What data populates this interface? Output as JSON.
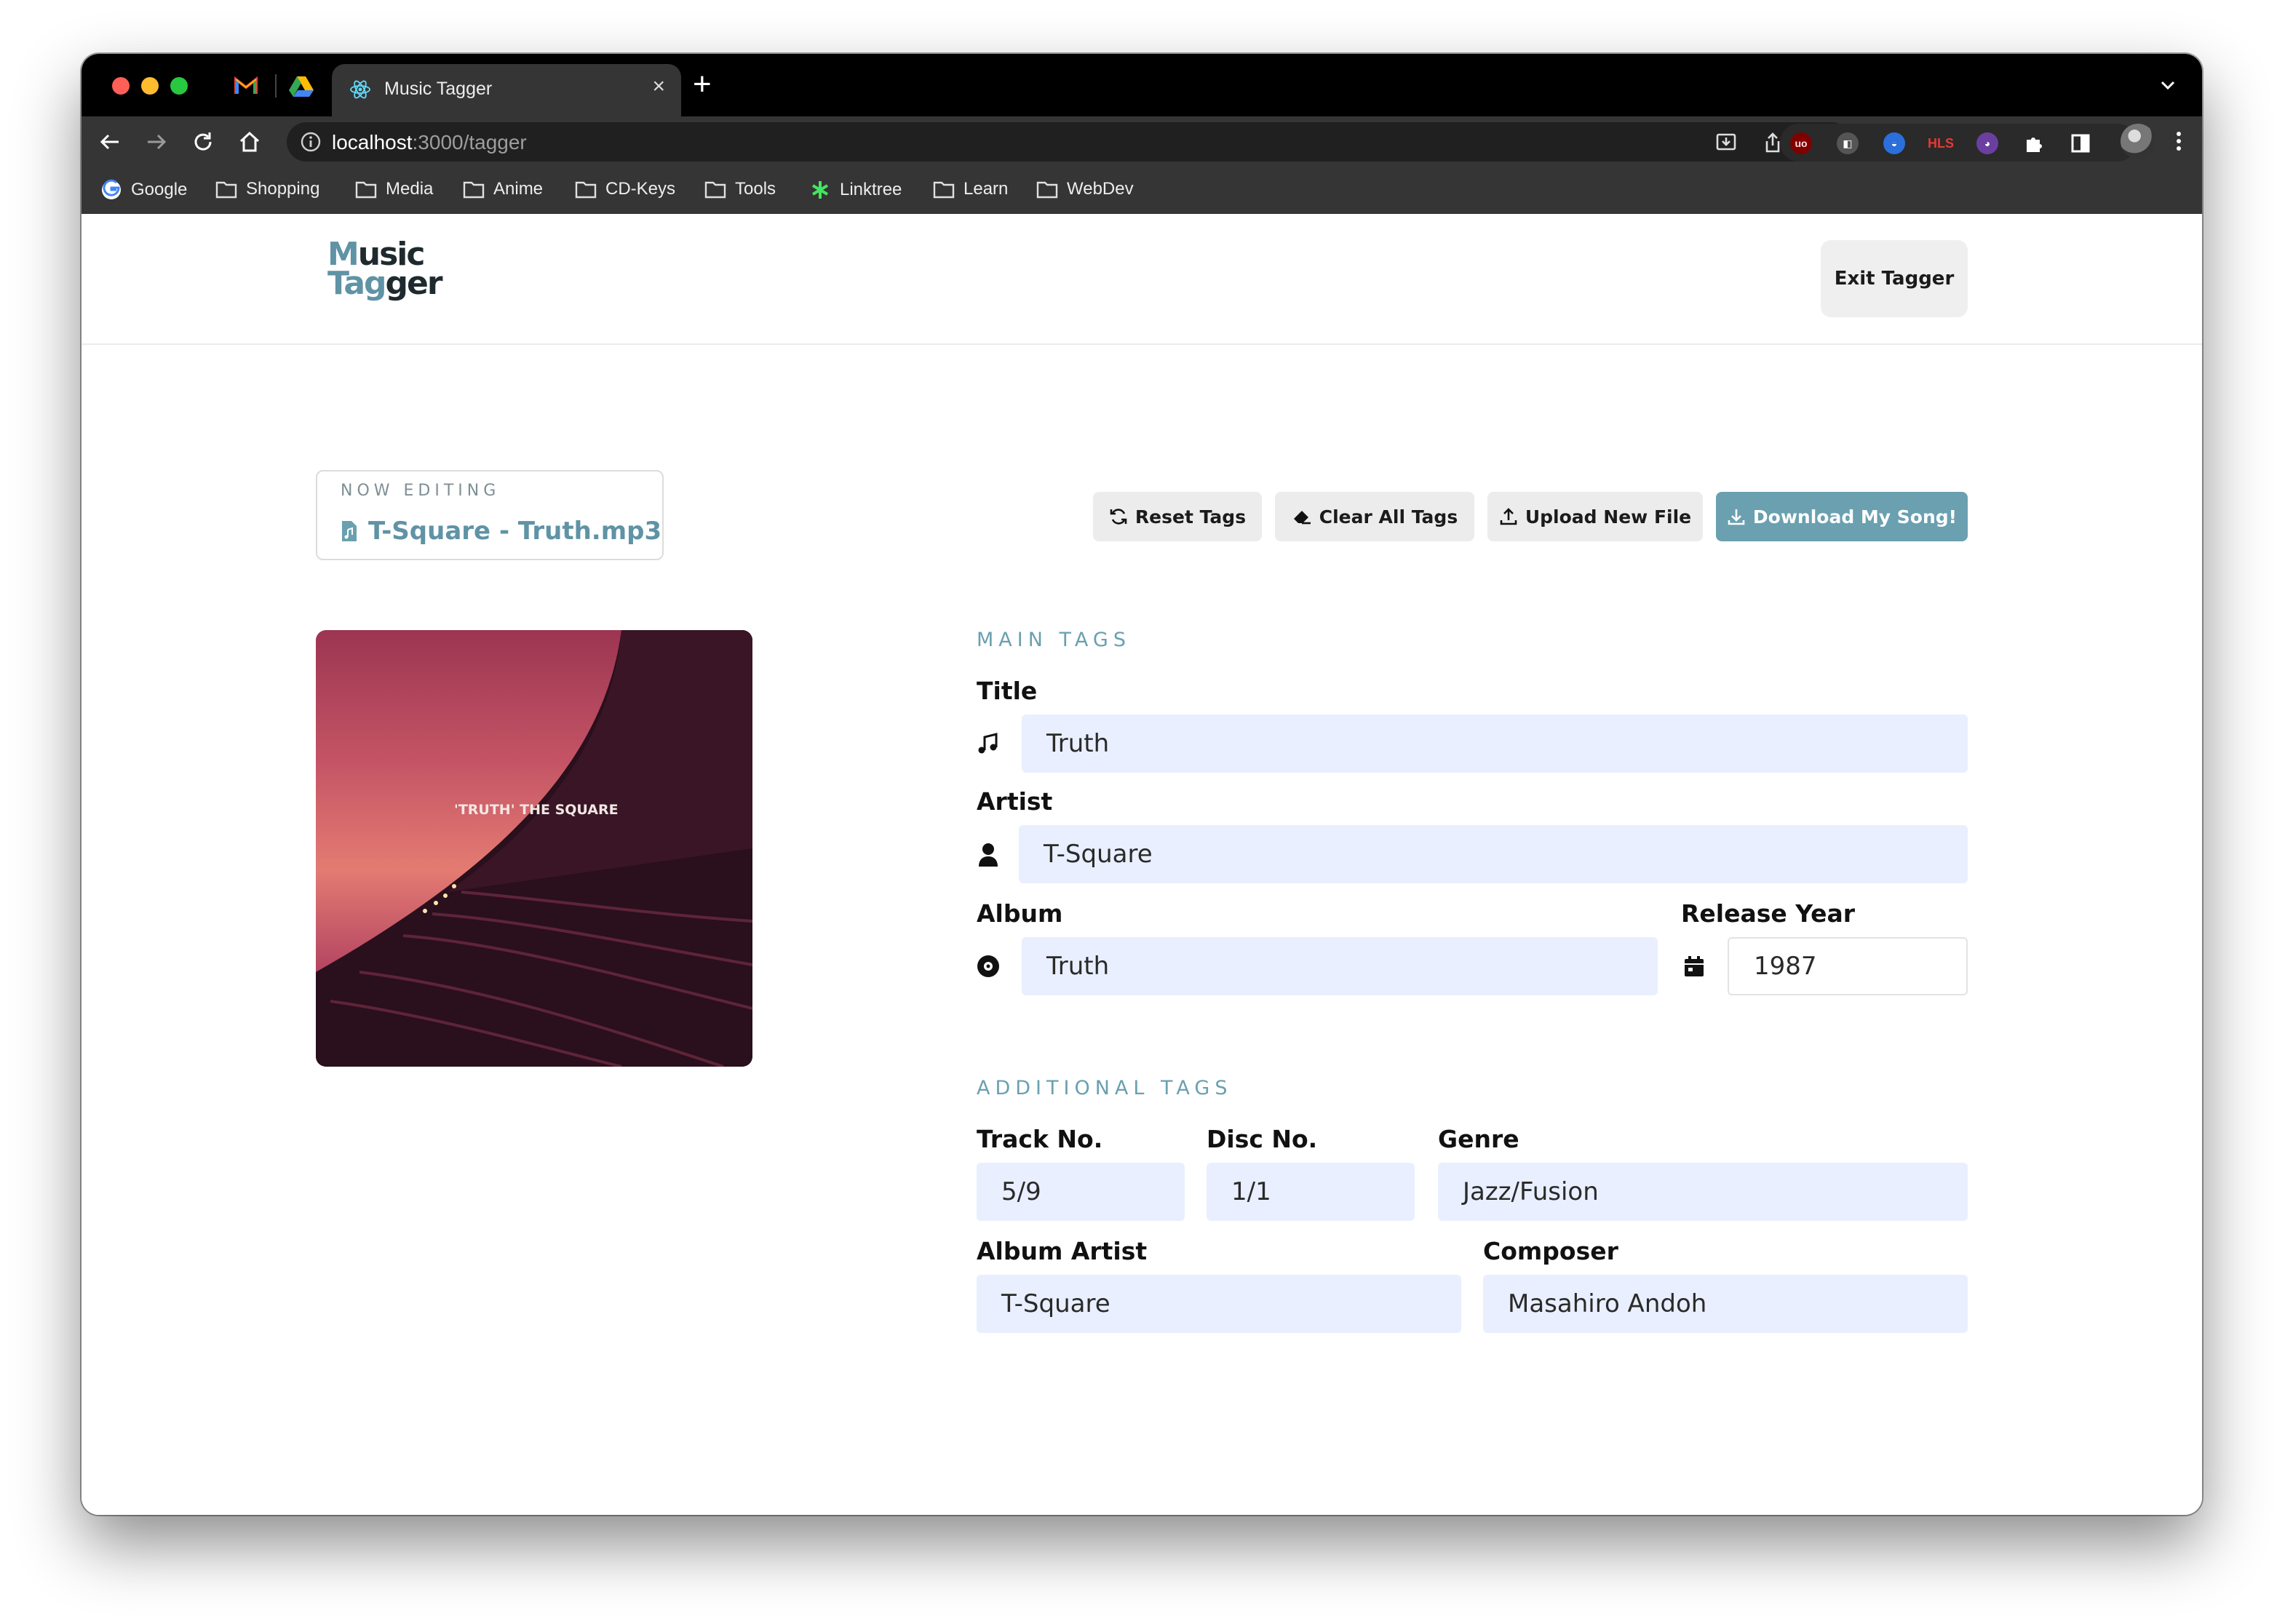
{
  "browser": {
    "tab_title": "Music Tagger",
    "url_host": "localhost",
    "url_path": ":3000/tagger",
    "bookmarks": [
      "Google",
      "Shopping",
      "Media",
      "Anime",
      "CD-Keys",
      "Tools",
      "Linktree",
      "Learn",
      "WebDev"
    ],
    "extensions": [
      "uBlock",
      "extension",
      "extension",
      "HLS",
      "extension"
    ]
  },
  "app": {
    "logo": {
      "line1_a": "M",
      "line1_b": "usic",
      "line2_a": "Ta",
      "line2_b": "g",
      "line2_c": "ger"
    },
    "exit_button": "Exit Tagger",
    "now_editing": {
      "caption": "NOW EDITING",
      "filename": "T-Square - Truth.mp3"
    },
    "actions": {
      "reset": "Reset Tags",
      "clear": "Clear All Tags",
      "upload": "Upload New File",
      "download": "Download My Song!"
    },
    "artwork_text": "'TRUTH' THE SQUARE",
    "main_tags": {
      "caption": "MAIN TAGS",
      "title": {
        "label": "Title",
        "value": "Truth"
      },
      "artist": {
        "label": "Artist",
        "value": "T-Square"
      },
      "album": {
        "label": "Album",
        "value": "Truth"
      },
      "year": {
        "label": "Release Year",
        "value": "1987"
      }
    },
    "additional_tags": {
      "caption": "ADDITIONAL TAGS",
      "track": {
        "label": "Track No.",
        "value": "5/9"
      },
      "disc": {
        "label": "Disc No.",
        "value": "1/1"
      },
      "genre": {
        "label": "Genre",
        "value": "Jazz/Fusion"
      },
      "album_artist": {
        "label": "Album Artist",
        "value": "T-Square"
      },
      "composer": {
        "label": "Composer",
        "value": "Masahiro Andoh"
      }
    }
  },
  "colors": {
    "accent": "#6aa0b0",
    "input_bg": "#e9effe",
    "button_bg": "#ececec",
    "browser_chrome": "#353535"
  }
}
